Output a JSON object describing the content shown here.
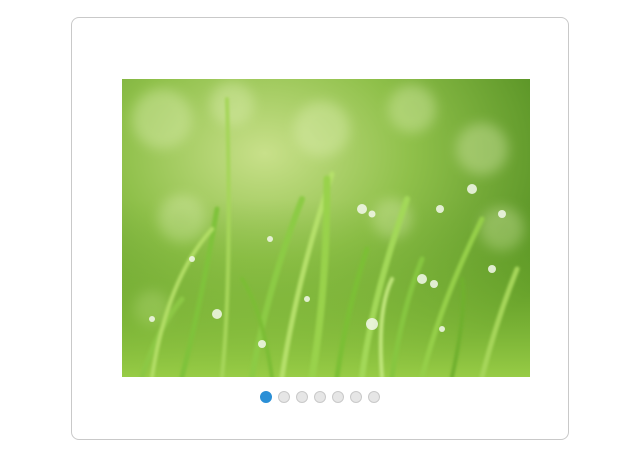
{
  "carousel": {
    "slide_image": "grass-with-dew-drops-photo",
    "slide_count": 7,
    "active_index": 0,
    "accent_color": "#2b8fd6",
    "inactive_color": "#e6e6e6"
  }
}
